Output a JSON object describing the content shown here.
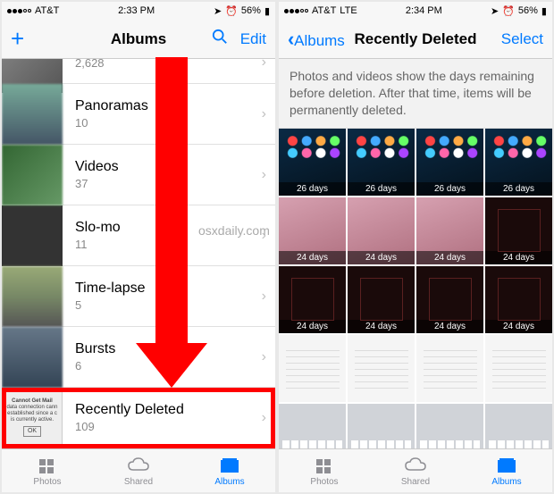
{
  "left": {
    "status": {
      "carrier": "AT&T",
      "net": "",
      "time": "2:33 PM",
      "battery": "56%"
    },
    "nav": {
      "title": "Albums",
      "edit": "Edit"
    },
    "albums": [
      {
        "name": "",
        "count": "2,628"
      },
      {
        "name": "Panoramas",
        "count": "10"
      },
      {
        "name": "Videos",
        "count": "37"
      },
      {
        "name": "Slo-mo",
        "count": "11"
      },
      {
        "name": "Time-lapse",
        "count": "5"
      },
      {
        "name": "Bursts",
        "count": "6"
      },
      {
        "name": "Recently Deleted",
        "count": "109"
      }
    ],
    "tabs": {
      "photos": "Photos",
      "shared": "Shared",
      "albums": "Albums"
    },
    "mailAlert": {
      "title": "Cannot Get Mail",
      "body": "data connection cann\nestablished since a c\nis currently active.",
      "ok": "OK"
    }
  },
  "right": {
    "status": {
      "carrier": "AT&T",
      "net": "LTE",
      "time": "2:34 PM",
      "battery": "56%"
    },
    "nav": {
      "back": "Albums",
      "title": "Recently Deleted",
      "select": "Select"
    },
    "banner": "Photos and videos show the days remaining before deletion. After that time, items will be permanently deleted.",
    "days": [
      "26 days",
      "26 days",
      "26 days",
      "26 days",
      "24 days",
      "24 days",
      "24 days",
      "24 days",
      "24 days",
      "24 days",
      "24 days",
      "24 days",
      "",
      "",
      "",
      ""
    ],
    "tabs": {
      "photos": "Photos",
      "shared": "Shared",
      "albums": "Albums"
    }
  },
  "watermark": "osxdaily.com"
}
